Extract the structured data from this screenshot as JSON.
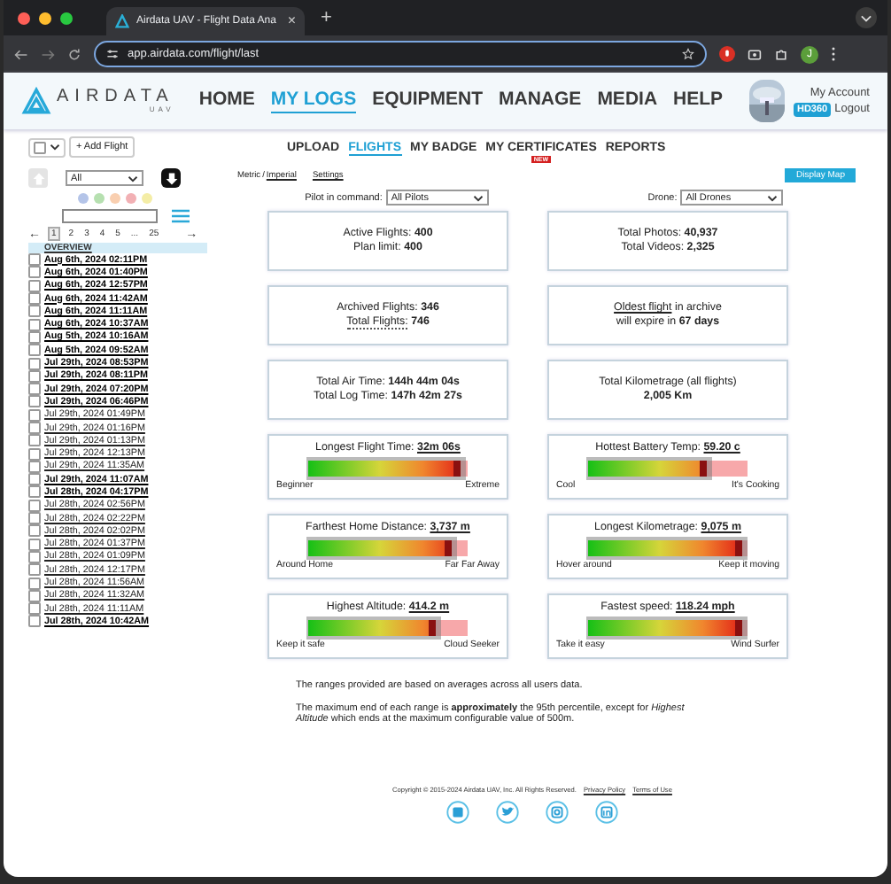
{
  "browser": {
    "tab_title": "Airdata UAV - Flight Data Ana",
    "new_tab": "+",
    "tab_close": "×",
    "url": "app.airdata.com/flight/last",
    "profile_initial": "J"
  },
  "logo": {
    "name": "AIRDATA",
    "sub": "UAV"
  },
  "nav": [
    {
      "label": "HOME",
      "selected": false
    },
    {
      "label": "MY LOGS",
      "selected": true
    },
    {
      "label": "EQUIPMENT",
      "selected": false
    },
    {
      "label": "MANAGE",
      "selected": false
    },
    {
      "label": "MEDIA",
      "selected": false
    },
    {
      "label": "HELP",
      "selected": false
    }
  ],
  "account": {
    "link": "My Account",
    "badge": "HD360",
    "logout": "Logout"
  },
  "subnav": [
    {
      "label": "UPLOAD",
      "selected": false
    },
    {
      "label": "FLIGHTS",
      "selected": true
    },
    {
      "label": "MY BADGE",
      "selected": false
    },
    {
      "label": "MY CERTIFICATES",
      "selected": false,
      "badge": "NEW"
    },
    {
      "label": "REPORTS",
      "selected": false
    }
  ],
  "sidebar": {
    "select_all": {
      "checked": false
    },
    "add_button": "+ Add Flight",
    "filter": "All",
    "tag_colors": [
      {
        "color": "#b4c4e8"
      },
      {
        "color": "#b6e0b0"
      },
      {
        "color": "#f9cfb0"
      },
      {
        "color": "#f2b0b4"
      },
      {
        "color": "#f4eda6"
      }
    ],
    "pager": {
      "prev": "←",
      "next": "→",
      "pages": [
        {
          "label": "1",
          "selected": true
        },
        {
          "label": "2",
          "selected": false
        },
        {
          "label": "3",
          "selected": false
        },
        {
          "label": "4",
          "selected": false
        },
        {
          "label": "5",
          "selected": false
        },
        {
          "label": "...",
          "selected": false
        },
        {
          "label": "25",
          "selected": false
        }
      ]
    },
    "overview": "OVERVIEW",
    "flights": [
      {
        "label": "Aug 6th, 2024 02:11PM",
        "unviewed": true,
        "checked": false
      },
      {
        "label": "Aug 6th, 2024 01:40PM",
        "unviewed": true,
        "checked": false
      },
      {
        "label": "Aug 6th, 2024 12:57PM",
        "unviewed": true,
        "checked": false
      },
      {
        "label": "Aug 6th, 2024 11:42AM",
        "unviewed": true,
        "checked": false
      },
      {
        "label": "Aug 6th, 2024 11:11AM",
        "unviewed": true,
        "checked": false
      },
      {
        "label": "Aug 6th, 2024 10:37AM",
        "unviewed": true,
        "checked": false
      },
      {
        "label": "Aug 5th, 2024 10:16AM",
        "unviewed": true,
        "checked": false
      },
      {
        "label": "Aug 5th, 2024 09:52AM",
        "unviewed": true,
        "checked": false
      },
      {
        "label": "Jul 29th, 2024 08:53PM",
        "unviewed": true,
        "checked": false
      },
      {
        "label": "Jul 29th, 2024 08:11PM",
        "unviewed": true,
        "checked": false
      },
      {
        "label": "Jul 29th, 2024 07:20PM",
        "unviewed": true,
        "checked": false
      },
      {
        "label": "Jul 29th, 2024 06:46PM",
        "unviewed": true,
        "checked": false
      },
      {
        "label": "Jul 29th, 2024 01:49PM",
        "unviewed": false,
        "checked": false
      },
      {
        "label": "Jul 29th, 2024 01:16PM",
        "unviewed": false,
        "checked": false
      },
      {
        "label": "Jul 29th, 2024 01:13PM",
        "unviewed": false,
        "checked": false
      },
      {
        "label": "Jul 29th, 2024 12:13PM",
        "unviewed": false,
        "checked": false
      },
      {
        "label": "Jul 29th, 2024 11:35AM",
        "unviewed": false,
        "checked": false
      },
      {
        "label": "Jul 29th, 2024 11:07AM",
        "unviewed": true,
        "checked": false
      },
      {
        "label": "Jul 28th, 2024 04:17PM",
        "unviewed": true,
        "checked": false
      },
      {
        "label": "Jul 28th, 2024 02:56PM",
        "unviewed": false,
        "checked": false
      },
      {
        "label": "Jul 28th, 2024 02:22PM",
        "unviewed": false,
        "checked": false
      },
      {
        "label": "Jul 28th, 2024 02:02PM",
        "unviewed": false,
        "checked": false
      },
      {
        "label": "Jul 28th, 2024 01:37PM",
        "unviewed": false,
        "checked": false
      },
      {
        "label": "Jul 28th, 2024 01:09PM",
        "unviewed": false,
        "checked": false
      },
      {
        "label": "Jul 28th, 2024 12:17PM",
        "unviewed": false,
        "checked": false
      },
      {
        "label": "Jul 28th, 2024 11:56AM",
        "unviewed": false,
        "checked": false
      },
      {
        "label": "Jul 28th, 2024 11:32AM",
        "unviewed": false,
        "checked": false
      },
      {
        "label": "Jul 28th, 2024 11:11AM",
        "unviewed": false,
        "checked": false
      },
      {
        "label": "Jul 28th, 2024 10:42AM",
        "unviewed": true,
        "checked": false
      }
    ]
  },
  "units": {
    "metric": "Metric",
    "separator": "/",
    "imperial": "Imperial",
    "settings": "Settings",
    "map_button": "Display Map"
  },
  "filters": [
    {
      "label": "Pilot in command:",
      "value": "All Pilots"
    },
    {
      "label": "Drone:",
      "value": "All Drones"
    }
  ],
  "stat_cards": [
    {
      "lines": [
        {
          "kind": "pair",
          "label": "Active Flights:",
          "value": "400"
        },
        {
          "kind": "pair",
          "label": "Plan limit:",
          "value": "400"
        }
      ]
    },
    {
      "lines": [
        {
          "kind": "pair",
          "label": "Total Photos:",
          "value": "40,937"
        },
        {
          "kind": "pair",
          "label": "Total Videos:",
          "value": "2,325"
        }
      ]
    },
    {
      "lines": [
        {
          "kind": "pair",
          "label": "Archived Flights:",
          "value": "346"
        },
        {
          "kind": "dotted_pair",
          "label": "Total Flights:",
          "value": "746"
        }
      ]
    },
    {
      "lines": [
        {
          "kind": "link",
          "link": "Oldest flight",
          "text": "in archive"
        },
        {
          "kind": "pair",
          "label": "will expire in",
          "value": "67 days"
        }
      ]
    },
    {
      "lines": [
        {
          "kind": "pair",
          "label": "Total Air Time:",
          "value": "144h 44m 04s"
        },
        {
          "kind": "pair",
          "label": "Total Log Time:",
          "value": "147h 42m 27s"
        }
      ]
    },
    {
      "lines": [
        {
          "kind": "text",
          "text": "Total Kilometrage (all flights)"
        },
        {
          "kind": "value",
          "value": "2,005 Km"
        }
      ]
    }
  ],
  "gauges": [
    {
      "title": "Longest Flight Time:",
      "value": "32m 06s",
      "level": 0.95,
      "low": "Beginner",
      "high": "Extreme"
    },
    {
      "title": "Hottest Battery Temp:",
      "value": "59.20 c",
      "level": 0.74,
      "low": "Cool",
      "high": "It's Cooking"
    },
    {
      "title": "Farthest Home Distance:",
      "value": "3,737 m",
      "level": 0.9,
      "low": "Around Home",
      "high": "Far Far Away"
    },
    {
      "title": "Longest Kilometrage:",
      "value": "9,075 m",
      "level": 0.97,
      "low": "Hover around",
      "high": "Keep it moving"
    },
    {
      "title": "Highest Altitude:",
      "value": "414.2 m",
      "level": 0.8,
      "low": "Keep it safe",
      "high": "Cloud Seeker"
    },
    {
      "title": "Fastest speed:",
      "value": "118.24 mph",
      "level": 0.97,
      "low": "Take it easy",
      "high": "Wind Surfer"
    }
  ],
  "notes": [
    "The ranges provided are based on averages across all users data.",
    "The maximum end of each range is **approximately** the 95th percentile, except for *Highest Altitude* which ends at the maximum configurable value of 500m."
  ],
  "footer": {
    "copyright": "Copyright © 2015-2024 Airdata UAV, Inc. All Rights Reserved.",
    "links": [
      "Privacy Policy",
      "Terms of Use"
    ]
  }
}
